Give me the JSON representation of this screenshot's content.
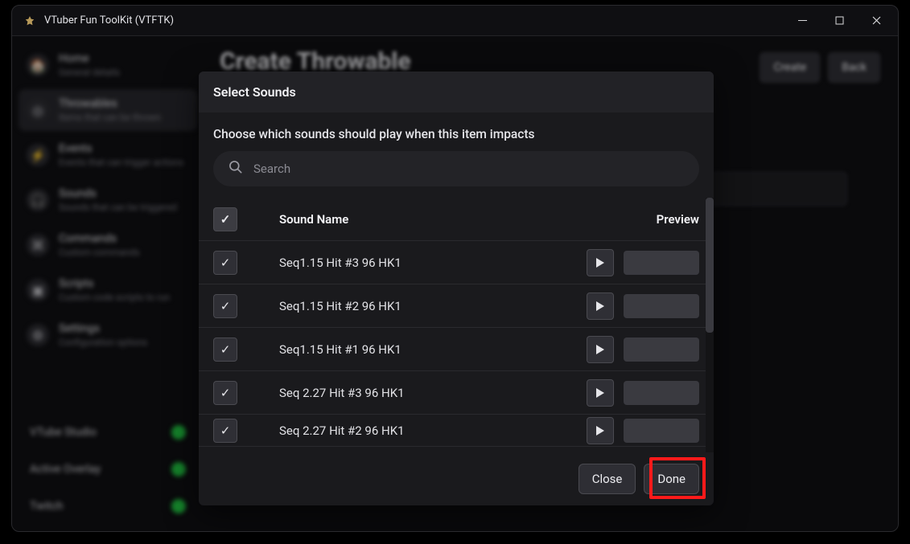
{
  "window": {
    "title": "VTuber Fun ToolKit (VTFTK)"
  },
  "sidebar": {
    "items": [
      {
        "title": "Home",
        "subtitle": "General details"
      },
      {
        "title": "Throwables",
        "subtitle": "Items that can be thrown"
      },
      {
        "title": "Events",
        "subtitle": "Events that can trigger actions"
      },
      {
        "title": "Sounds",
        "subtitle": "Sounds that can be triggered"
      },
      {
        "title": "Commands",
        "subtitle": "Custom commands"
      },
      {
        "title": "Scripts",
        "subtitle": "Custom code scripts to run"
      },
      {
        "title": "Settings",
        "subtitle": "Configuration options"
      }
    ],
    "status": [
      {
        "label": "VTube Studio"
      },
      {
        "label": "Active Overlay"
      },
      {
        "label": "Twitch"
      }
    ]
  },
  "main": {
    "heading": "Create Throwable",
    "create_label": "Create",
    "back_label": "Back"
  },
  "modal": {
    "title": "Select Sounds",
    "description": "Choose which sounds should play when this item impacts",
    "search_placeholder": "Search",
    "header_name": "Sound Name",
    "header_preview": "Preview",
    "close_label": "Close",
    "done_label": "Done",
    "rows": [
      {
        "name": "Seq1.15 Hit #3 96 HK1"
      },
      {
        "name": "Seq1.15 Hit #2 96 HK1"
      },
      {
        "name": "Seq1.15 Hit #1 96 HK1"
      },
      {
        "name": "Seq 2.27 Hit #3 96 HK1"
      },
      {
        "name": "Seq 2.27 Hit #2 96 HK1"
      }
    ]
  }
}
